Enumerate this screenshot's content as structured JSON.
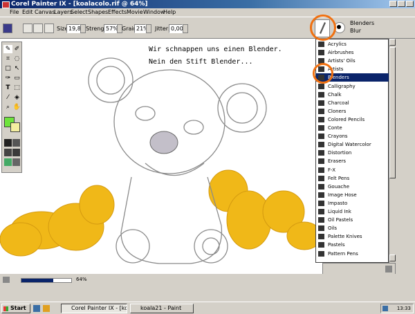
{
  "window": {
    "title": "Corel Painter IX - [koalacolo.rif @ 64%]"
  },
  "menu": [
    "File",
    "Edit",
    "Canvas",
    "Layers",
    "Select",
    "Shapes",
    "Effects",
    "Movie",
    "Window",
    "Help"
  ],
  "property_bar": {
    "size_label": "Size:",
    "size_value": "19,8",
    "strength_label": "Strength:",
    "strength_value": "57%",
    "grain_label": "Grain:",
    "grain_value": "21%",
    "jitter_label": "Jitter:",
    "jitter_value": "0,00"
  },
  "brush_selector": {
    "category": "Blenders",
    "variant": "Blur"
  },
  "annotation": {
    "line1": "Wir schnappen uns einen Blender.",
    "line2": "Nein den Stift Blender..."
  },
  "brush_categories": [
    "Acrylics",
    "Airbrushes",
    "Artists' Oils",
    "Artists",
    "Blenders",
    "Calligraphy",
    "Chalk",
    "Charcoal",
    "Cloners",
    "Colored Pencils",
    "Conte",
    "Crayons",
    "Digital Watercolor",
    "Distortion",
    "Erasers",
    "F-X",
    "Felt Pens",
    "Gouache",
    "Image Hose",
    "Impasto",
    "Liquid Ink",
    "Oil Pastels",
    "Oils",
    "Palette Knives",
    "Pastels",
    "Pattern Pens"
  ],
  "selected_brush": "Blenders",
  "status": {
    "zoom": "64%",
    "zoom_fraction": 0.64
  },
  "taskbar": {
    "start": "Start",
    "tasks": [
      "Corel Painter IX - [ko...",
      "koala21 - Paint"
    ],
    "clock": "13:33"
  },
  "colors": {
    "accent": "#0a246a",
    "highlight_ring": "#f07010",
    "main_color": "#6ee43c",
    "additional_color": "#f4eea0"
  }
}
